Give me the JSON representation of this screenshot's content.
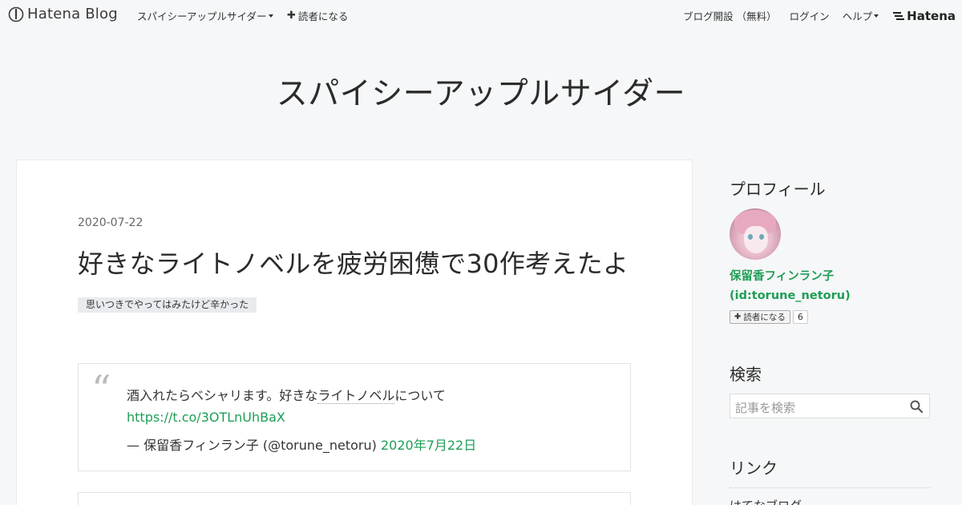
{
  "topbar": {
    "logo_text": "Hatena Blog",
    "blog_menu": "スパイシーアップルサイダー",
    "subscribe": "読者になる",
    "create_blog": "ブログ開設 （無料）",
    "login": "ログイン",
    "help": "ヘルプ",
    "hatena": "Hatena"
  },
  "blog": {
    "title": "スパイシーアップルサイダー"
  },
  "entry": {
    "date": "2020-07-22",
    "title": "好きなライトノベルを疲労困憊で30作考えたよ",
    "category": "思いつきでやってはみたけど辛かった",
    "quote": {
      "text_prefix": "酒入れたらベシャリます。好きな",
      "text_dotted": "ライトノベル",
      "text_suffix": "について",
      "url": "https://t.co/3OTLnUhBaX",
      "author": "— 保留香フィンラン子 (@torune_netoru)",
      "date": "2020年7月22日"
    }
  },
  "sidebar": {
    "profile_heading": "プロフィール",
    "name": "保留香フィンラン子",
    "id": "(id:torune_netoru)",
    "subscribe_label": "読者になる",
    "subscriber_count": "6",
    "search_heading": "検索",
    "search_placeholder": "記事を検索",
    "links_heading": "リンク",
    "link_1": "はてなブログ"
  },
  "colors": {
    "background": "#f6f7f8",
    "link_green": "#1e9e55",
    "category_bg": "#e8ecef"
  }
}
